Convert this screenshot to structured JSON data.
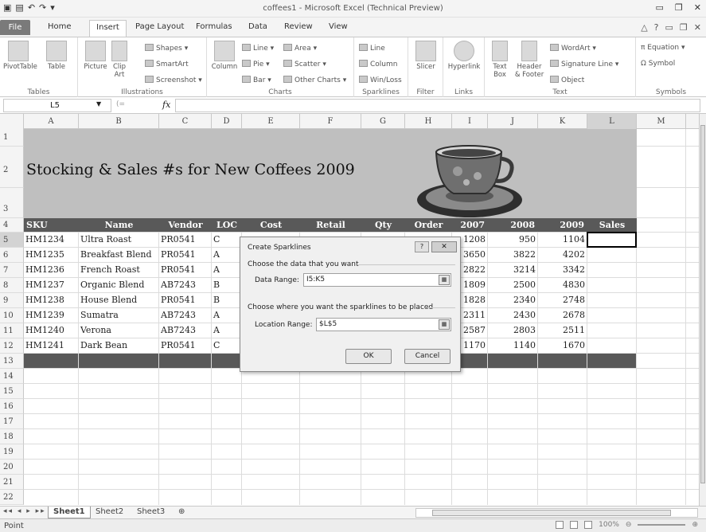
{
  "window": {
    "title": "coffees1 - Microsoft Excel (Technical Preview)"
  },
  "tabs": [
    "File",
    "Home",
    "Insert",
    "Page Layout",
    "Formulas",
    "Data",
    "Review",
    "View"
  ],
  "ribbon": {
    "tables": {
      "pivottable": "PivotTable",
      "table": "Table",
      "label": "Tables"
    },
    "illustrations": {
      "picture": "Picture",
      "clipart": "Clip Art",
      "shapes": "Shapes",
      "smartart": "SmartArt",
      "screenshot": "Screenshot",
      "label": "Illustrations"
    },
    "charts": {
      "column": "Column",
      "line": "Line",
      "pie": "Pie",
      "bar": "Bar",
      "area": "Area",
      "scatter": "Scatter",
      "other": "Other Charts",
      "label": "Charts"
    },
    "sparklines": {
      "line": "Line",
      "column": "Column",
      "winloss": "Win/Loss",
      "label": "Sparklines"
    },
    "filter": {
      "slicer": "Slicer",
      "label": "Filter"
    },
    "links": {
      "hyperlink": "Hyperlink",
      "label": "Links"
    },
    "text": {
      "textbox": "Text Box",
      "headerfooter": "Header & Footer",
      "wordart": "WordArt",
      "signature": "Signature Line",
      "object": "Object",
      "label": "Text"
    },
    "symbols": {
      "equation": "Equation",
      "symbol": "Symbol",
      "label": "Symbols"
    }
  },
  "formula_bar": {
    "name_box": "L5",
    "fx": "fx",
    "content": ""
  },
  "columns": [
    "A",
    "B",
    "C",
    "D",
    "E",
    "F",
    "G",
    "H",
    "I",
    "J",
    "K",
    "L",
    "M"
  ],
  "rows": [
    "1",
    "2",
    "3",
    "4",
    "5",
    "6",
    "7",
    "8",
    "9",
    "10",
    "11",
    "12",
    "13",
    "14",
    "15",
    "16",
    "17",
    "18",
    "19",
    "20",
    "21",
    "22"
  ],
  "sheet": {
    "title": "Stocking & Sales #s for New Coffees 2009",
    "headers": {
      "sku": "SKU",
      "name": "Name",
      "vendor": "Vendor",
      "loc": "LOC",
      "cost": "Cost",
      "retail": "Retail",
      "qty": "Qty",
      "order": "Order",
      "y2007": "2007",
      "y2008": "2008",
      "y2009": "2009",
      "sales": "Sales"
    },
    "data": [
      {
        "sku": "HM1234",
        "name": "Ultra Roast",
        "vendor": "PR0541",
        "loc": "C",
        "y2007": "1208",
        "y2008": "950",
        "y2009": "1104"
      },
      {
        "sku": "HM1235",
        "name": "Breakfast Blend",
        "vendor": "PR0541",
        "loc": "A",
        "y2007": "3650",
        "y2008": "3822",
        "y2009": "4202"
      },
      {
        "sku": "HM1236",
        "name": "French Roast",
        "vendor": "PR0541",
        "loc": "A",
        "y2007": "2822",
        "y2008": "3214",
        "y2009": "3342"
      },
      {
        "sku": "HM1237",
        "name": "Organic Blend",
        "vendor": "AB7243",
        "loc": "B",
        "y2007": "1809",
        "y2008": "2500",
        "y2009": "4830"
      },
      {
        "sku": "HM1238",
        "name": "House Blend",
        "vendor": "PR0541",
        "loc": "B",
        "y2007": "1828",
        "y2008": "2340",
        "y2009": "2748"
      },
      {
        "sku": "HM1239",
        "name": "Sumatra",
        "vendor": "AB7243",
        "loc": "A",
        "y2007": "2311",
        "y2008": "2430",
        "y2009": "2678"
      },
      {
        "sku": "HM1240",
        "name": "Verona",
        "vendor": "AB7243",
        "loc": "A",
        "y2007": "2587",
        "y2008": "2803",
        "y2009": "2511"
      },
      {
        "sku": "HM1241",
        "name": "Dark Bean",
        "vendor": "PR0541",
        "loc": "C",
        "y2007": "1170",
        "y2008": "1140",
        "y2009": "1670"
      }
    ]
  },
  "sheet_tabs": [
    "Sheet1",
    "Sheet2",
    "Sheet3"
  ],
  "status": {
    "mode": "Point",
    "zoom": "100%"
  },
  "dialog": {
    "title": "Create Sparklines",
    "help": "?",
    "close": "✕",
    "section1": "Choose the data that you want",
    "data_range_label": "Data Range:",
    "data_range_value": "I5:K5",
    "section2": "Choose where you want the sparklines to be placed",
    "location_range_label": "Location Range:",
    "location_range_value": "$L$5",
    "ok": "OK",
    "cancel": "Cancel"
  },
  "colors": {
    "banner": "#bfbfbf",
    "header_band": "#595959",
    "file_tab": "#7a7a7a"
  }
}
